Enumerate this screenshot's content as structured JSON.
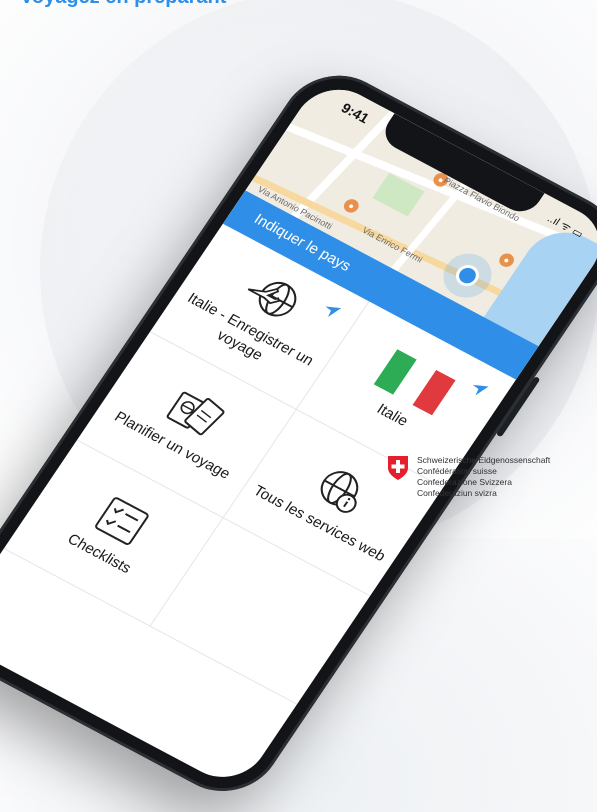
{
  "headline": "Voyagez en préparant",
  "status": {
    "time": "9:41",
    "icons": "..ıl ᯤ ▭"
  },
  "map": {
    "labels": [
      "Piazza Flavio Biondo",
      "Via Enrico Fermi",
      "Via Antonio Pacinotti"
    ]
  },
  "banner": {
    "label": "Indiquer le pays"
  },
  "tiles": [
    {
      "label": "Italie - Enregistrer un voyage",
      "icon": "plane-globe-icon",
      "has_arrow": true
    },
    {
      "label": "Italie",
      "icon": "italy-flag",
      "has_arrow": true
    },
    {
      "label": "Planifier un voyage",
      "icon": "passport-icon",
      "has_arrow": false
    },
    {
      "label": "Tous les services web",
      "icon": "info-globe-icon",
      "has_arrow": false
    },
    {
      "label": "Checklists",
      "icon": "checklist-icon",
      "has_arrow": false
    },
    {
      "label": "",
      "icon": "",
      "has_arrow": false
    }
  ],
  "flag_colors": [
    "#2eab55",
    "#ffffff",
    "#e13a3e"
  ],
  "accent_color": "#2f8fe8",
  "logo": {
    "lines": [
      "Schweizerische Eidgenossenschaft",
      "Confédération suisse",
      "Confederazione Svizzera",
      "Confederaziun svizra"
    ]
  }
}
